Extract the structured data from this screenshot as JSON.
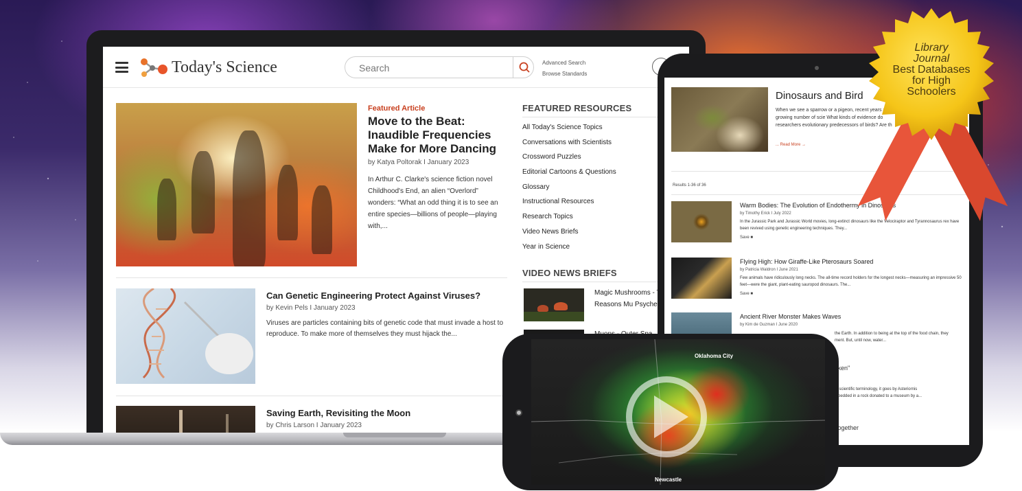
{
  "site": {
    "brand": "Today's Science",
    "search_placeholder": "Search",
    "advanced_search": "Advanced Search",
    "browse_standards": "Browse Standards"
  },
  "featured": {
    "label": "Featured Article",
    "title": "Move to the Beat: Inaudible Frequencies Make for More Dancing",
    "byline": "by Katya Poltorak I January 2023",
    "excerpt": "In Arthur C. Clarke's science fiction novel Childhood's End, an alien “Overlord” wonders: “What an odd thing it is to see an entire species—billions of people—playing with,..."
  },
  "articles": [
    {
      "title": "Can Genetic Engineering Protect Against Viruses?",
      "byline": "by Kevin Pels I January 2023",
      "excerpt": "Viruses are particles containing bits of genetic code that must invade a host to reproduce. To make more of themselves they must hijack the..."
    },
    {
      "title": "Saving Earth, Revisiting the Moon",
      "byline": "by Chris Larson I January 2023"
    }
  ],
  "resources": {
    "heading": "FEATURED RESOURCES",
    "items": [
      "All Today's Science Topics",
      "Conversations with Scientists",
      "Crossword Puzzles",
      "Editorial Cartoons & Questions",
      "Glossary",
      "Instructional Resources",
      "Research Topics",
      "Video News Briefs",
      "Year in Science"
    ]
  },
  "video_briefs": {
    "heading": "VIDEO NEWS BRIEFS",
    "items": [
      "Magic Mushrooms - Trippy Reasons Mu Psychedelic",
      "Muons - Outer Spa"
    ]
  },
  "tablet": {
    "hero_title": "Dinosaurs and Bird",
    "hero_text": "When we see a sparrow or a pigeon, recent years a growing number of scie What kinds of evidence do researchers evolutionary predecessors of birds? Are th",
    "read_more": "... Read More →",
    "results": "Results 1-36 of 36",
    "rows": [
      {
        "title": "Warm Bodies: The Evolution of Endothermy in Dinosaurs",
        "byline": "by Timothy Erick I July 2022",
        "text": "In the Jurassic Park and Jurassic World movies, long-extinct dinosaurs like the Velociraptor and Tyrannosaurus rex have been revived using genetic engineering techniques. They...",
        "save": "Save ■"
      },
      {
        "title": "Flying High: How Giraffe-Like Pterosaurs Soared",
        "byline": "by Patricia Waldron I June 2021",
        "text": "Few animals have ridiculously long necks. The all-time record holders for the longest necks—measuring an impressive 50 feet—were the giant, plant-eating sauropod dinosaurs. The...",
        "save": "Save ■"
      },
      {
        "title": "Ancient River Monster Makes Waves",
        "byline": "by Kim de Guzman I June 2020",
        "text_a": "the Earth. In addition to being at the top of the food chain, they",
        "text_b": "ment. But, until now, water..."
      }
    ],
    "frag_1": "cken\"",
    "frag_2": "in scientific terminology, it goes by Asteriornis",
    "frag_3": "mbedded in a rock donated to a museum by a...",
    "frag_4": "Together"
  },
  "badge": {
    "line1": "Library",
    "line2": "Journal",
    "line3": "Best Databases",
    "line4": "for High",
    "line5": "Schoolers"
  },
  "phone": {
    "city_1": "Oklahoma City",
    "city_2": "Newcastle"
  },
  "colors": {
    "accent": "#c8401f",
    "badge_gold": "#f5c518",
    "ribbon_red": "#e8553a"
  }
}
